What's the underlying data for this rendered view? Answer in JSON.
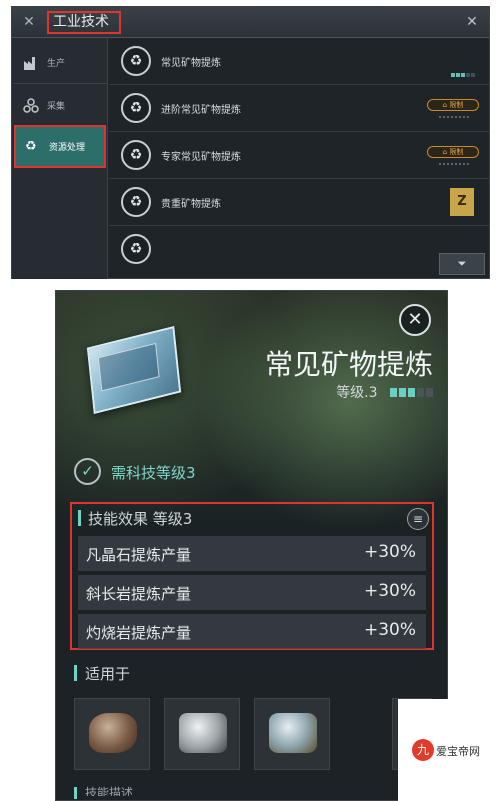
{
  "top_window": {
    "title": "工业技术",
    "close_icon": "close-icon",
    "sidebar": [
      {
        "label": "生产",
        "icon": "factory-icon"
      },
      {
        "label": "采集",
        "icon": "nodes-icon"
      },
      {
        "label": "资源处理",
        "icon": "recycle-icon"
      }
    ],
    "rows": [
      {
        "label": "常见矿物提炼",
        "icon": "recycle-icon",
        "status": "level",
        "level": 3,
        "max_level": 5
      },
      {
        "label": "进阶常见矿物提炼",
        "icon": "recycle-icon",
        "status": "badge",
        "badge": "限制"
      },
      {
        "label": "专家常见矿物提炼",
        "icon": "recycle-icon",
        "status": "badge",
        "badge": "限制"
      },
      {
        "label": "贵重矿物提炼",
        "icon": "recycle-icon",
        "status": "z",
        "z_label": "Z"
      }
    ],
    "filter_icon": "filter-icon"
  },
  "detail": {
    "title": "常见矿物提炼",
    "level_label": "等级.3",
    "level": 3,
    "max_level": 5,
    "requirement": "需科技等级3",
    "effect_title": "技能效果 等级3",
    "effects": [
      {
        "name": "凡晶石提炼产量",
        "value": "+30%"
      },
      {
        "name": "斜长岩提炼产量",
        "value": "+30%"
      },
      {
        "name": "灼烧岩提炼产量",
        "value": "+30%"
      }
    ],
    "applies_title": "适用于",
    "next_section_title": "技能描述"
  },
  "watermark": {
    "text": "爱宝帝网",
    "logo_char": "九"
  },
  "colors": {
    "highlight": "#e0342f",
    "accent": "#6fd3c5",
    "selected_bg": "#2b6e6a",
    "badge": "#e0a543"
  }
}
